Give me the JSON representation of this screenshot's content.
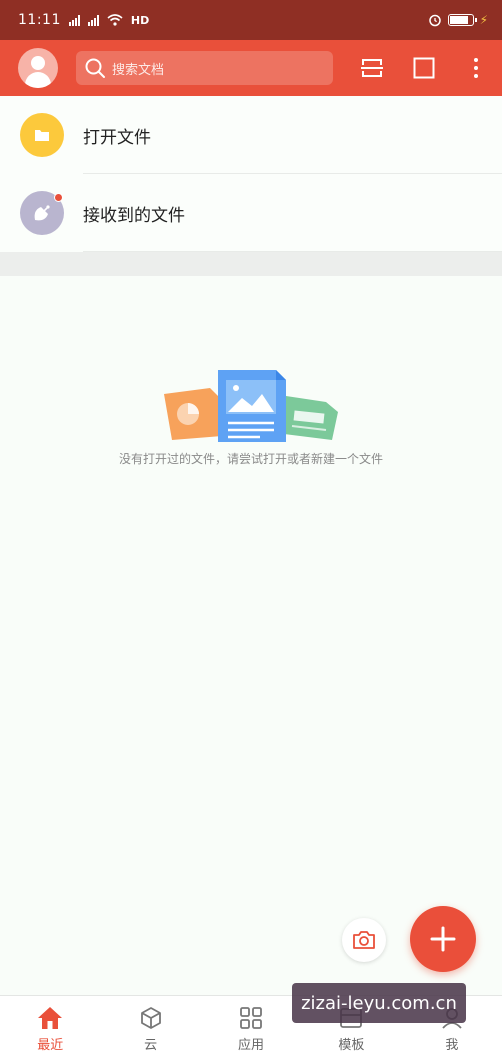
{
  "status_bar": {
    "time": "11:11",
    "network": "HD",
    "battery_level": 0.85
  },
  "toolbar": {
    "search_placeholder": "搜索文档"
  },
  "list": {
    "items": [
      {
        "label": "打开文件",
        "color": "#fcc93c"
      },
      {
        "label": "接收到的文件",
        "color": "#b9b5cf",
        "has_badge": true
      }
    ]
  },
  "empty_state": {
    "message": "没有打开过的文件，请尝试打开或者新建一个文件"
  },
  "bottom_nav": {
    "items": [
      {
        "label": "最近",
        "icon": "home-icon",
        "active": true
      },
      {
        "label": "云",
        "icon": "cube-icon",
        "active": false
      },
      {
        "label": "应用",
        "icon": "grid-icon",
        "active": false
      },
      {
        "label": "模板",
        "icon": "template-icon",
        "active": false
      },
      {
        "label": "我",
        "icon": "user-icon",
        "active": false
      }
    ]
  },
  "watermark": {
    "text": "zizai-leyu.com.cn"
  },
  "colors": {
    "accent": "#e9503a",
    "status_bar": "#8f2f24"
  }
}
